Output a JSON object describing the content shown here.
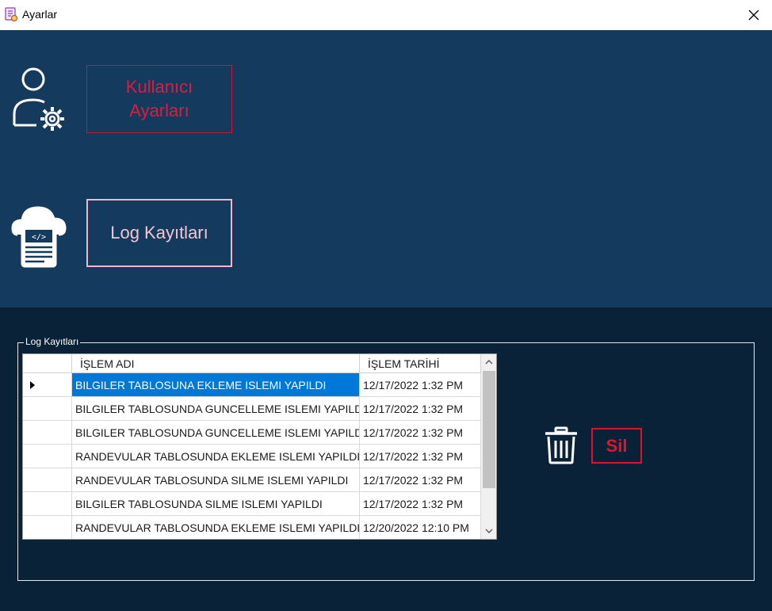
{
  "window": {
    "title": "Ayarlar",
    "app_icon": "settings-app-icon",
    "close_icon": "close-icon"
  },
  "top_panel": {
    "user_settings_button": {
      "label": "Kullanıcı Ayarları",
      "icon": "user-gear-icon"
    },
    "log_button": {
      "label": "Log Kayıtları",
      "icon": "cloud-code-document-icon"
    }
  },
  "log_group": {
    "title": "Log Kayıtları",
    "grid": {
      "columns": [
        "",
        "İŞLEM ADI",
        "İŞLEM TARİHİ"
      ],
      "rows": [
        {
          "name": "BILGILER TABLOSUNA EKLEME ISLEMI YAPILDI",
          "date": "12/17/2022 1:32 PM",
          "selected": true
        },
        {
          "name": "BILGILER TABLOSUNDA GUNCELLEME ISLEMI YAPILDI",
          "date": "12/17/2022 1:32 PM"
        },
        {
          "name": "BILGILER TABLOSUNDA GUNCELLEME ISLEMI YAPILDI",
          "date": "12/17/2022 1:32 PM"
        },
        {
          "name": "RANDEVULAR TABLOSUNDA EKLEME ISLEMI YAPILDI",
          "date": "12/17/2022 1:32 PM"
        },
        {
          "name": "RANDEVULAR TABLOSUNDA SILME ISLEMI YAPILDI",
          "date": "12/17/2022 1:32 PM"
        },
        {
          "name": "BILGILER TABLOSUNDA SILME ISLEMI YAPILDI",
          "date": "12/17/2022 1:32 PM"
        },
        {
          "name": "RANDEVULAR TABLOSUNDA EKLEME ISLEMI YAPILDI",
          "date": "12/20/2022 12:10 PM"
        }
      ]
    },
    "delete_button": {
      "label": "Sil",
      "icon": "trash-icon"
    }
  },
  "colors": {
    "top_panel_bg": "#143a5e",
    "bottom_panel_bg": "#0a2238",
    "accent_red": "#e01a40",
    "selection_blue": "#0078d7"
  }
}
